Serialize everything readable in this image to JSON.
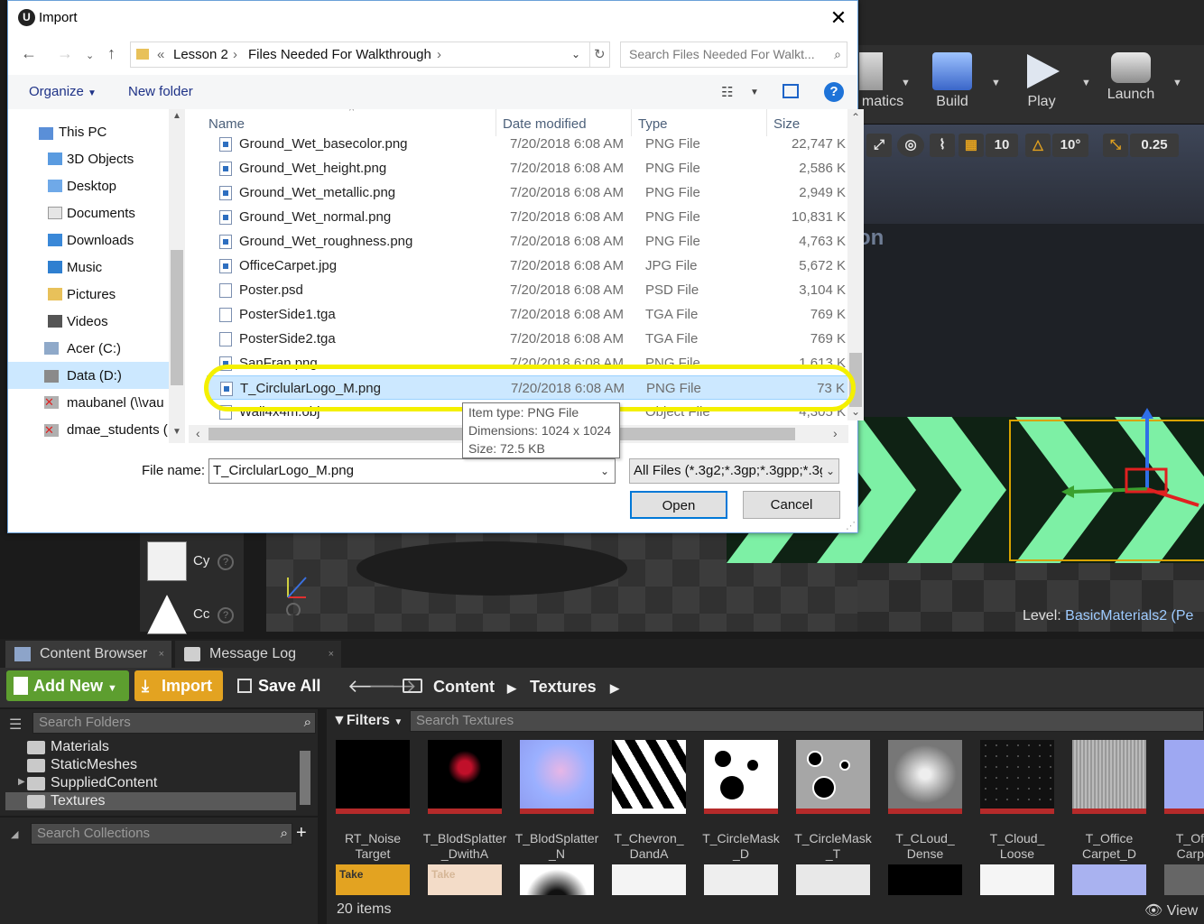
{
  "ue": {
    "toolbar": {
      "cinematics_label": "matics",
      "build_label": "Build",
      "play_label": "Play",
      "launch_label": "Launch"
    },
    "viewport": {
      "grid_snap": "10",
      "rot_snap": "10°",
      "scale_snap": "0.25",
      "level_prefix": "Level:",
      "level_name": "BasicMaterials2 (Pe",
      "watermark_text": "on"
    },
    "modes": [
      {
        "label": "Cy",
        "help": "?"
      },
      {
        "label": "Cc",
        "help": "?"
      }
    ],
    "tabs": [
      {
        "label": "Content Browser",
        "close": "×"
      },
      {
        "label": "Message Log",
        "close": "×"
      }
    ],
    "content_browser": {
      "add_new": "Add New",
      "import": "Import",
      "save_all": "Save All",
      "breadcrumb": [
        "Content",
        "Textures"
      ],
      "search_folders": "Search Folders",
      "folders": [
        "Materials",
        "StaticMeshes",
        "SuppliedContent",
        "Textures"
      ],
      "search_collections": "Search Collections",
      "filters": "Filters",
      "search_textures": "Search Textures",
      "assets": [
        {
          "l1": "RT_Noise",
          "l2": "Target"
        },
        {
          "l1": "T_BlodSplatter",
          "l2": "_DwithA"
        },
        {
          "l1": "T_BlodSplatter",
          "l2": "_N"
        },
        {
          "l1": "T_Chevron_",
          "l2": "DandA"
        },
        {
          "l1": "T_CircleMask",
          "l2": "_D"
        },
        {
          "l1": "T_CircleMask",
          "l2": "_T"
        },
        {
          "l1": "T_CLoud_",
          "l2": "Dense"
        },
        {
          "l1": "T_Cloud_",
          "l2": "Loose"
        },
        {
          "l1": "T_Office",
          "l2": "Carpet_D"
        },
        {
          "l1": "T_Of",
          "l2": "Carp"
        }
      ],
      "row2_badges": [
        "Take",
        "Take"
      ],
      "item_count": "20 items",
      "view_label": "View"
    }
  },
  "dialog": {
    "title": "Import",
    "address": [
      "Lesson 2",
      "Files Needed For Walkthrough"
    ],
    "address_prefix": "«",
    "search_placeholder": "Search Files Needed For Walkt...",
    "organize": "Organize",
    "new_folder": "New folder",
    "nav_items": [
      "This PC",
      "3D Objects",
      "Desktop",
      "Documents",
      "Downloads",
      "Music",
      "Pictures",
      "Videos",
      "Acer (C:)",
      "Data (D:)",
      "maubanel (\\\\vau",
      "dmae_students ("
    ],
    "columns": {
      "name": "Name",
      "date": "Date modified",
      "type": "Type",
      "size": "Size"
    },
    "files": [
      {
        "name": "Ground_Wet_basecolor.png",
        "date": "7/20/2018 6:08 AM",
        "type": "PNG File",
        "size": "22,747 K",
        "icon": "png"
      },
      {
        "name": "Ground_Wet_height.png",
        "date": "7/20/2018 6:08 AM",
        "type": "PNG File",
        "size": "2,586 K",
        "icon": "png"
      },
      {
        "name": "Ground_Wet_metallic.png",
        "date": "7/20/2018 6:08 AM",
        "type": "PNG File",
        "size": "2,949 K",
        "icon": "png"
      },
      {
        "name": "Ground_Wet_normal.png",
        "date": "7/20/2018 6:08 AM",
        "type": "PNG File",
        "size": "10,831 K",
        "icon": "png"
      },
      {
        "name": "Ground_Wet_roughness.png",
        "date": "7/20/2018 6:08 AM",
        "type": "PNG File",
        "size": "4,763 K",
        "icon": "png"
      },
      {
        "name": "OfficeCarpet.jpg",
        "date": "7/20/2018 6:08 AM",
        "type": "JPG File",
        "size": "5,672 K",
        "icon": "png"
      },
      {
        "name": "Poster.psd",
        "date": "7/20/2018 6:08 AM",
        "type": "PSD File",
        "size": "3,104 K",
        "icon": "doc"
      },
      {
        "name": "PosterSide1.tga",
        "date": "7/20/2018 6:08 AM",
        "type": "TGA File",
        "size": "769 K",
        "icon": "doc"
      },
      {
        "name": "PosterSide2.tga",
        "date": "7/20/2018 6:08 AM",
        "type": "TGA File",
        "size": "769 K",
        "icon": "doc"
      },
      {
        "name": "SanFran.png",
        "date": "7/20/2018 6:08 AM",
        "type": "PNG File",
        "size": "1,613 K",
        "icon": "png"
      },
      {
        "name": "T_CirclularLogo_M.png",
        "date": "7/20/2018 6:08 AM",
        "type": "PNG File",
        "size": "73 K",
        "icon": "png",
        "selected": true
      },
      {
        "name": "Wall4x4m.obj",
        "date": "",
        "type": "Object File",
        "size": "4,305 K",
        "icon": "doc"
      }
    ],
    "tooltip": [
      "Item type: PNG File",
      "Dimensions: 1024 x 1024",
      "Size: 72.5 KB"
    ],
    "file_name_label": "File name:",
    "file_name_value": "T_CirclularLogo_M.png",
    "file_type": "All Files (*.3g2;*.3gp;*.3gpp;*.3g",
    "open": "Open",
    "cancel": "Cancel"
  },
  "colors": {
    "highlight": "#f4f000",
    "import_btn": "#e3a321",
    "add_new_btn": "#5d9e2f",
    "chevron": "#7df0a5"
  }
}
